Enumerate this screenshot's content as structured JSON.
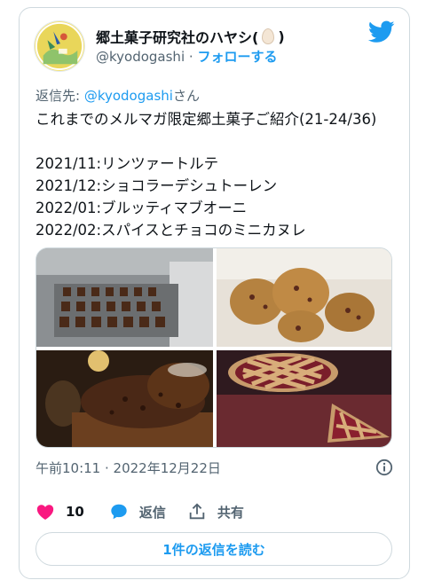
{
  "author": {
    "display_name": "郷土菓子研究社のハヤシ(",
    "display_name_end": ")",
    "handle": "@kyodogashi",
    "separator": "·",
    "follow_label": "フォローする"
  },
  "reply_to": {
    "prefix": "返信先: ",
    "mention": "@kyodogashi",
    "suffix": "さん"
  },
  "tweet": {
    "lines": [
      "これまでのメルマガ限定郷土菓子ご紹介(21-24/36)",
      "",
      "2021/11:リンツァートルテ",
      "2021/12:ショコラーデシュトーレン",
      "2022/01:ブルッティマブオーニ",
      "2022/02:スパイスとチョコのミニカヌレ"
    ]
  },
  "timestamp": "午前10:11 · 2022年12月22日",
  "actions": {
    "like_count": "10",
    "reply_label": "返信",
    "share_label": "共有"
  },
  "read_replies_label": "1件の返信を読む",
  "colors": {
    "accent": "#1d9bf0",
    "like": "#f91880",
    "secondary_text": "#536471",
    "border": "#cfd9de"
  }
}
